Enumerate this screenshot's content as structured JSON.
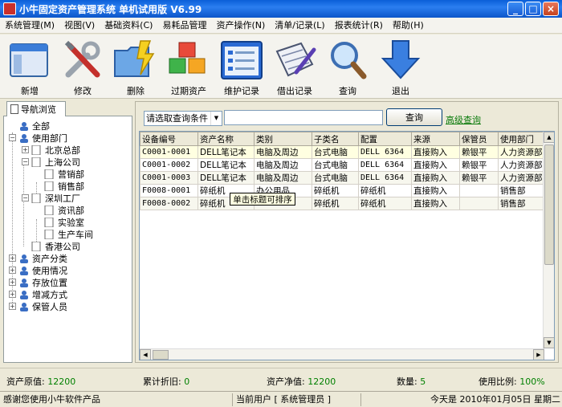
{
  "window": {
    "title": "小牛固定资产管理系统 单机试用版 V6.99",
    "minimize": "_",
    "maximize": "□",
    "close": "×"
  },
  "menu": [
    "系统管理(M)",
    "视图(V)",
    "基础资料(C)",
    "易耗品管理",
    "资产操作(N)",
    "清单/记录(L)",
    "报表统计(R)",
    "帮助(H)"
  ],
  "toolbar": {
    "new": "新增",
    "edit": "修改",
    "delete": "删除",
    "expired": "过期资产",
    "maintain": "维护记录",
    "lend": "借出记录",
    "query": "查询",
    "exit": "退出"
  },
  "nav": {
    "tab": "导航浏览",
    "tree": {
      "all": "全部",
      "dept": "使用部门",
      "beijing": "北京总部",
      "shanghai": "上海公司",
      "sales1": "营销部",
      "sales2": "销售部",
      "shenzhen": "深圳工厂",
      "info": "资讯部",
      "lab": "实验室",
      "workshop": "生产车间",
      "hongkong": "香港公司",
      "category": "资产分类",
      "usage": "使用情况",
      "location": "存放位置",
      "change": "增减方式",
      "keeper": "保管人员"
    }
  },
  "query": {
    "select": "请选取查询条件",
    "button": "查询",
    "advanced": "高级查询"
  },
  "grid": {
    "columns": [
      "设备编号",
      "资产名称",
      "类别",
      "子类名",
      "配置",
      "来源",
      "保管员",
      "使用部门"
    ],
    "rows": [
      [
        "C0001-0001",
        "DELL笔记本",
        "电脑及周边",
        "台式电脑",
        "DELL 6364",
        "直接购入",
        "赖银平",
        "人力资源部"
      ],
      [
        "C0001-0002",
        "DELL笔记本",
        "电脑及周边",
        "台式电脑",
        "DELL 6364",
        "直接购入",
        "赖银平",
        "人力资源部"
      ],
      [
        "C0001-0003",
        "DELL笔记本",
        "电脑及周边",
        "台式电脑",
        "DELL 6364",
        "直接购入",
        "赖银平",
        "人力资源部"
      ],
      [
        "F0008-0001",
        "碎纸机",
        "办公用品",
        "碎纸机",
        "碎纸机",
        "直接购入",
        "",
        "销售部"
      ],
      [
        "F0008-0002",
        "碎纸机",
        "",
        "碎纸机",
        "碎纸机",
        "直接购入",
        "",
        "销售部"
      ]
    ],
    "tooltip": "单击标题可排序"
  },
  "summary": {
    "orig_label": "资产原值:",
    "orig": "12200",
    "dep_label": "累计折旧:",
    "dep": "0",
    "net_label": "资产净值:",
    "net": "12200",
    "count_label": "数量:",
    "count": "5",
    "ratio_label": "使用比例:",
    "ratio": "100%"
  },
  "status": {
    "thanks": "感谢您使用小牛软件产品",
    "user": "当前用户 [ 系统管理员 ]",
    "today": "今天是 2010年01月05日 星期二"
  }
}
